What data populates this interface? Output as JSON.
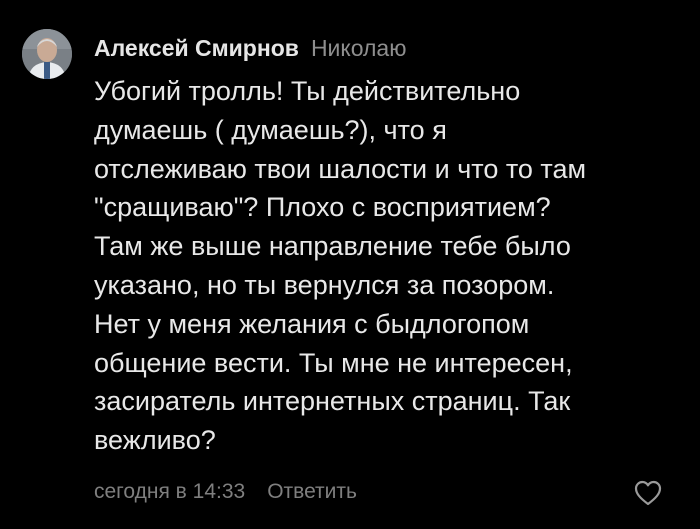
{
  "comment": {
    "author": "Алексей Смирнов",
    "reply_to": "Николаю",
    "lines": [
      "Убогий тролль! Ты действительно",
      "думаешь ( думаешь?), что я",
      "отслеживаю твои шалости и что то там",
      "\"сращиваю\"? Плохо с восприятием?",
      "Там же выше направление тебе было",
      "указано, но ты вернулся за позором.",
      "Нет у меня желания с быдлогопом",
      "общение вести. Ты мне не интересен,",
      "засиратель интернетных страниц. Так",
      "вежливо?"
    ],
    "time": "сегодня в 14:33",
    "reply_label": "Ответить"
  },
  "icons": {
    "avatar": "user-avatar-photo",
    "like": "heart-outline-icon"
  },
  "colors": {
    "background": "#000000",
    "text": "#e8e8e8",
    "secondary": "#8e8e8e"
  }
}
